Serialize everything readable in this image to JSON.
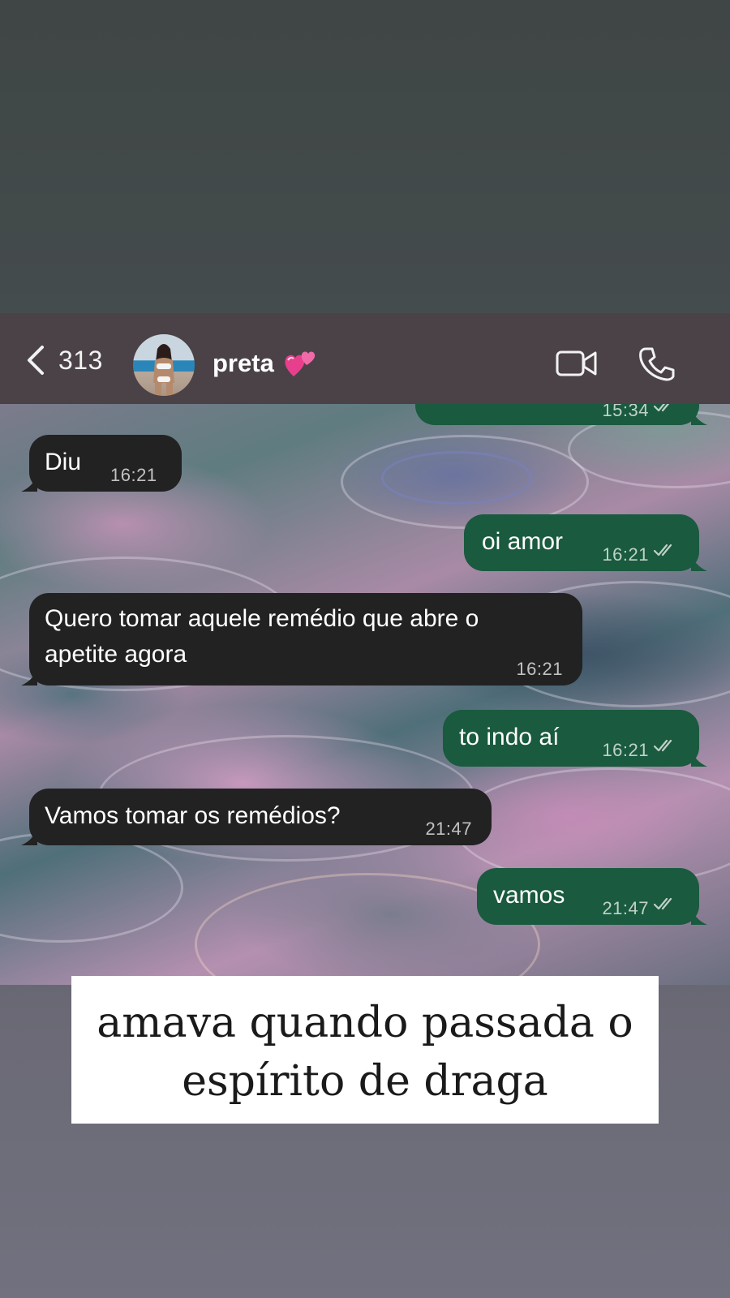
{
  "header": {
    "back_count": "313",
    "contact_name": "preta",
    "contact_emoji": "revolving-hearts-emoji",
    "icons": [
      "chevron-left-icon",
      "video-camera-icon",
      "phone-icon"
    ]
  },
  "messages": [
    {
      "direction": "outgoing",
      "text": "",
      "time": "15:34",
      "read": true
    },
    {
      "direction": "incoming",
      "text": "Diu",
      "time": "16:21"
    },
    {
      "direction": "outgoing",
      "text": "oi amor",
      "time": "16:21",
      "read": true
    },
    {
      "direction": "incoming",
      "text_line1": "Quero tomar aquele remédio que abre o",
      "text_line2": "apetite agora",
      "time": "16:21"
    },
    {
      "direction": "outgoing",
      "text": "to indo aí",
      "time": "16:21",
      "read": true
    },
    {
      "direction": "incoming",
      "text": "Vamos tomar os remédios?",
      "time": "21:47"
    },
    {
      "direction": "outgoing",
      "text": "vamos",
      "time": "21:47",
      "read": true
    }
  ],
  "caption": {
    "line1": "amava quando passada o",
    "line2": "espírito de draga"
  },
  "colors": {
    "incoming_bubble": "#222222",
    "outgoing_bubble": "#1a5a3f",
    "header_bg": "#4a4247"
  }
}
